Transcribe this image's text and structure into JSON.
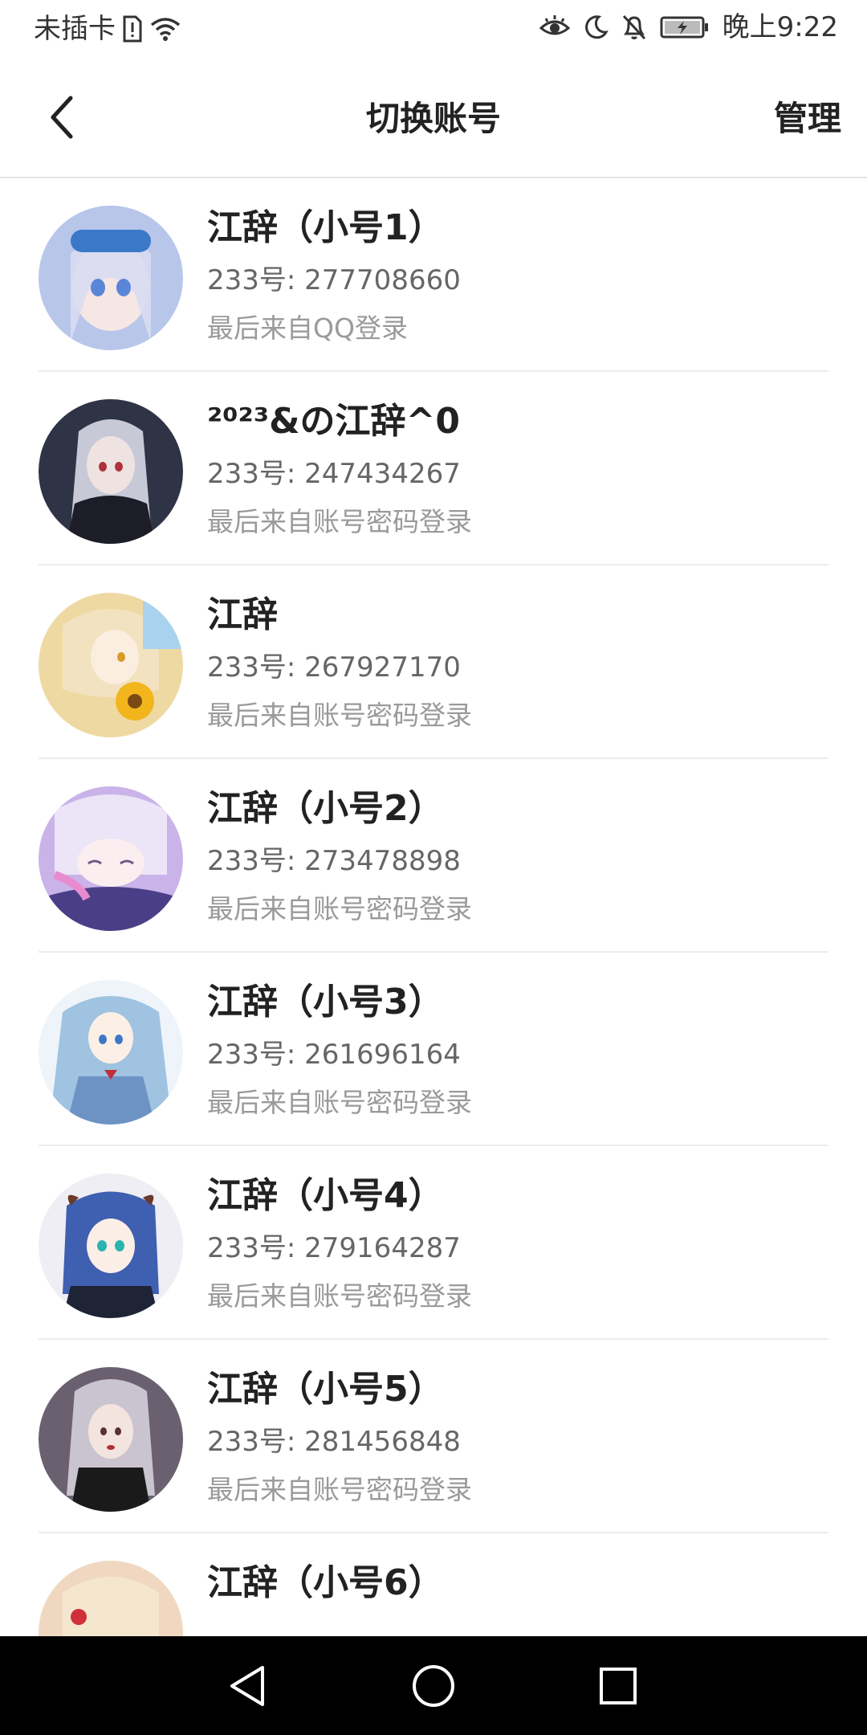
{
  "status_bar": {
    "carrier": "未插卡",
    "time": "晚上9:22",
    "icons": [
      "sim-alert-icon",
      "wifi-icon",
      "eye-comfort-icon",
      "moon-icon",
      "bell-muted-icon",
      "battery-charging-icon"
    ]
  },
  "header": {
    "title": "切换账号",
    "manage_label": "管理",
    "back_icon": "chevron-left-icon"
  },
  "accounts": [
    {
      "name": "江辞（小号1）",
      "id": "233号: 277708660",
      "login": "最后来自QQ登录",
      "avatar_color": "#b8c6ea"
    },
    {
      "name": "²⁰²³&の江辞^0",
      "id": "233号: 247434267",
      "login": "最后来自账号密码登录",
      "avatar_color": "#2f3346"
    },
    {
      "name": "江辞",
      "id": "233号: 267927170",
      "login": "最后来自账号密码登录",
      "avatar_color": "#efd9a3"
    },
    {
      "name": "江辞（小号2）",
      "id": "233号: 273478898",
      "login": "最后来自账号密码登录",
      "avatar_color": "#c9b3e8"
    },
    {
      "name": "江辞（小号3）",
      "id": "233号: 261696164",
      "login": "最后来自账号密码登录",
      "avatar_color": "#9fc3e0"
    },
    {
      "name": "江辞（小号4）",
      "id": "233号: 279164287",
      "login": "最后来自账号密码登录",
      "avatar_color": "#3f5fb0"
    },
    {
      "name": "江辞（小号5）",
      "id": "233号: 281456848",
      "login": "最后来自账号密码登录",
      "avatar_color": "#6b6070"
    },
    {
      "name": "江辞（小号6）",
      "id": "",
      "login": "",
      "avatar_color": "#f0d8c0"
    }
  ],
  "nav_bar": {
    "icons": [
      "nav-back-icon",
      "nav-home-icon",
      "nav-recents-icon"
    ]
  }
}
